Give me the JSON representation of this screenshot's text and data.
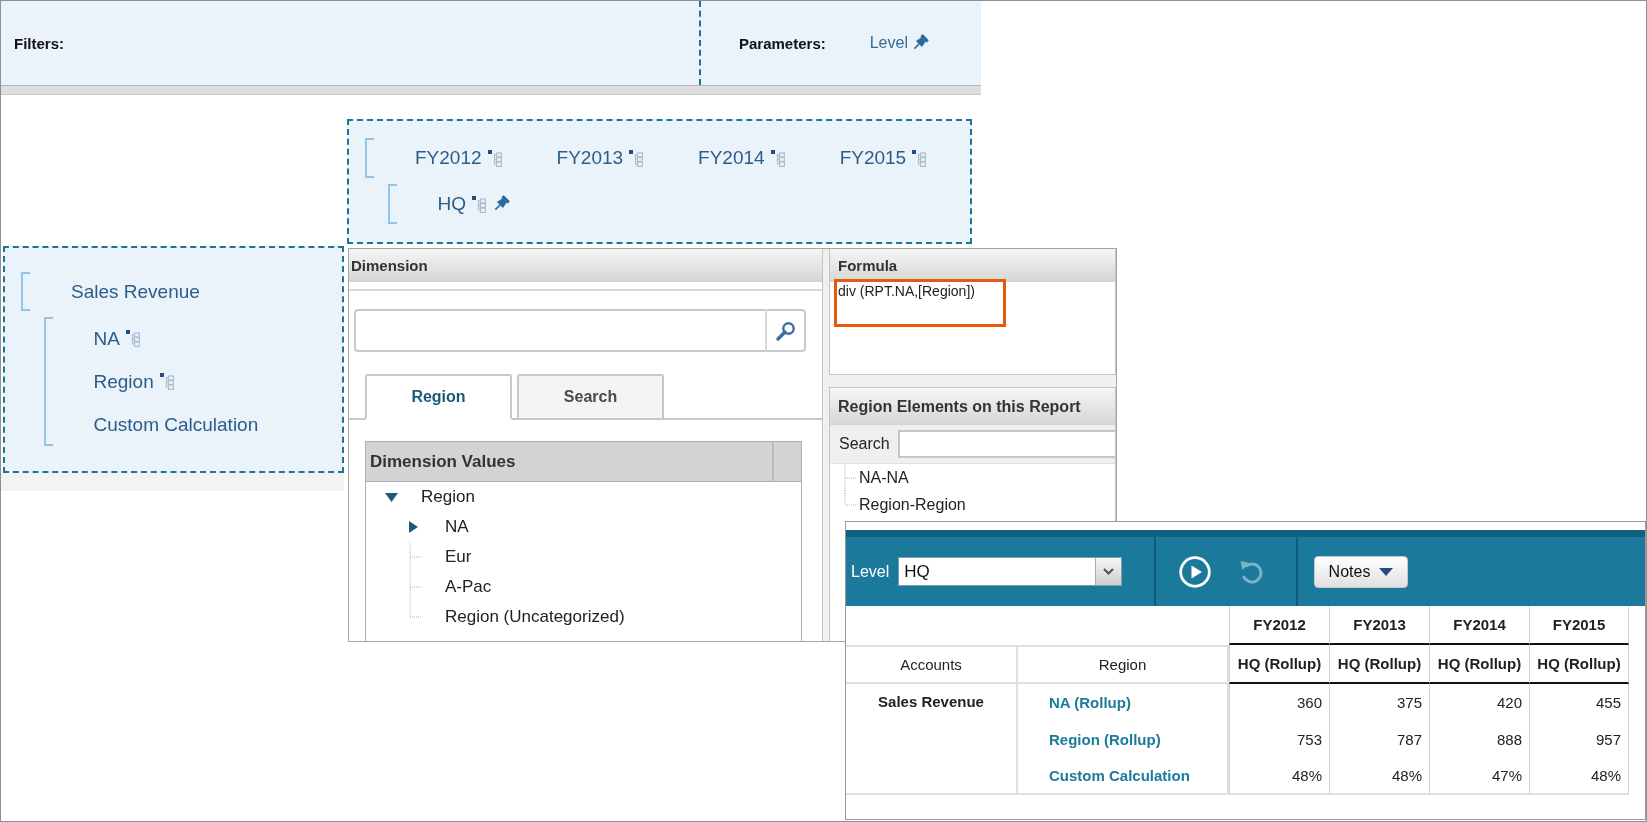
{
  "filter_bar": {
    "filters_label": "Filters:",
    "parameters_label": "Parameters:",
    "parameters": [
      {
        "label": "Level",
        "pinned": true
      }
    ]
  },
  "column_zone": {
    "groups": [
      {
        "items": [
          {
            "label": "FY2012",
            "hierarchy": true,
            "pinned": false
          },
          {
            "label": "FY2013",
            "hierarchy": true,
            "pinned": false
          },
          {
            "label": "FY2014",
            "hierarchy": true,
            "pinned": false
          },
          {
            "label": "FY2015",
            "hierarchy": true,
            "pinned": false
          }
        ]
      },
      {
        "items": [
          {
            "label": "HQ",
            "hierarchy": true,
            "pinned": true
          }
        ]
      }
    ]
  },
  "row_zone": {
    "groups": [
      {
        "items": [
          {
            "label": "Sales Revenue",
            "hierarchy": false,
            "pinned": false
          }
        ]
      },
      {
        "items": [
          {
            "label": "NA",
            "hierarchy": true,
            "pinned": false
          },
          {
            "label": "Region",
            "hierarchy": true,
            "pinned": false
          },
          {
            "label": "Custom Calculation",
            "hierarchy": false,
            "pinned": false
          }
        ]
      }
    ]
  },
  "dimension_panel": {
    "title": "Dimension",
    "tabs": [
      {
        "label": "Region",
        "selected": true
      },
      {
        "label": "Search",
        "selected": false
      }
    ],
    "values_header": "Dimension Values",
    "tree": [
      {
        "label": "Region",
        "kind": "branch",
        "expanded": true,
        "children": [
          {
            "label": "NA",
            "kind": "branch",
            "expanded": false
          },
          {
            "label": "Eur",
            "kind": "leaf"
          },
          {
            "label": "A-Pac",
            "kind": "leaf"
          },
          {
            "label": "Region (Uncategorized)",
            "kind": "leaf"
          }
        ]
      }
    ]
  },
  "formula_panel": {
    "title": "Formula",
    "formula": "div (RPT.NA,[Region])",
    "highlighted": true
  },
  "elements_panel": {
    "title": "Region Elements on this Report",
    "search_label": "Search",
    "items": [
      {
        "label": "NA-NA"
      },
      {
        "label": "Region-Region"
      }
    ]
  },
  "report": {
    "toolbar": {
      "level_label": "Level",
      "level_value": "HQ",
      "buttons": [
        {
          "kind": "run",
          "disabled": false
        },
        {
          "kind": "undo",
          "disabled": true
        }
      ],
      "notes_label": "Notes"
    },
    "table": {
      "row_headers": [
        "Accounts",
        "Region"
      ],
      "columns": [
        {
          "year": "FY2012",
          "member": "HQ (Rollup)"
        },
        {
          "year": "FY2013",
          "member": "HQ (Rollup)"
        },
        {
          "year": "FY2014",
          "member": "HQ (Rollup)"
        },
        {
          "year": "FY2015",
          "member": "HQ (Rollup)"
        }
      ],
      "accounts": [
        {
          "label": "Sales Revenue",
          "rows": [
            {
              "region": "NA (Rollup)",
              "values": [
                "360",
                "375",
                "420",
                "455"
              ]
            },
            {
              "region": "Region (Rollup)",
              "values": [
                "753",
                "787",
                "888",
                "957"
              ]
            },
            {
              "region": "Custom Calculation",
              "values": [
                "48%",
                "48%",
                "47%",
                "48%"
              ]
            }
          ]
        }
      ]
    }
  }
}
